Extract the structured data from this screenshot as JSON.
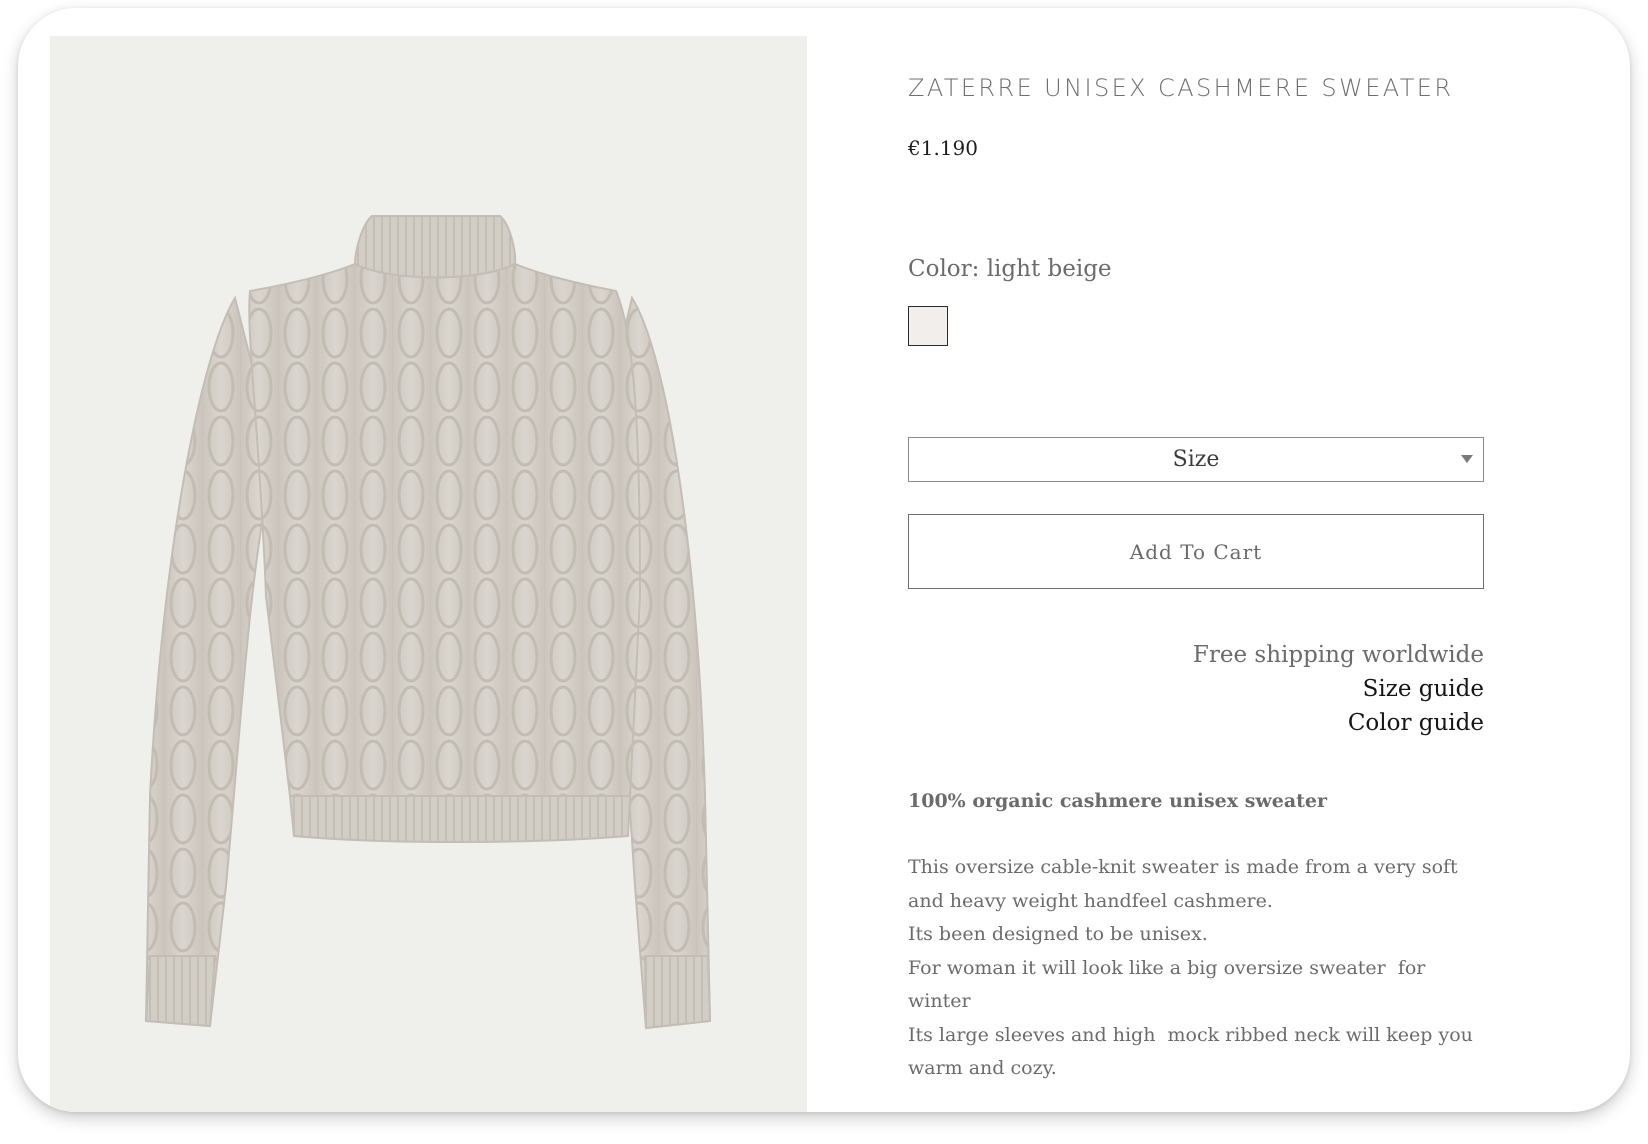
{
  "product": {
    "title": "ZATERRE UNISEX CASHMERE SWEATER",
    "price": "€1.190",
    "image_alt": "light beige cable-knit cashmere sweater",
    "color_label": "Color: light beige",
    "swatch_color": "#f2eeec",
    "size_placeholder": "Size",
    "add_to_cart": "Add To Cart"
  },
  "links": {
    "shipping": "Free shipping worldwide",
    "size_guide": "Size guide",
    "color_guide": "Color guide"
  },
  "description": {
    "heading": "100% organic cashmere unisex sweater",
    "lines": [
      "This oversize cable-knit sweater is made from a very soft",
      "and heavy weight handfeel cashmere.",
      "Its been designed to be unisex.",
      "For woman it will look like a big oversize sweater  for",
      "winter",
      "Its large sleeves and high  mock ribbed neck will keep you",
      "warm and cozy."
    ]
  },
  "colors": {
    "image_background": "#efefec",
    "sweater": "#d6d1ca",
    "price_text": "#1e1e1e",
    "body_text": "#6b6b6b"
  }
}
